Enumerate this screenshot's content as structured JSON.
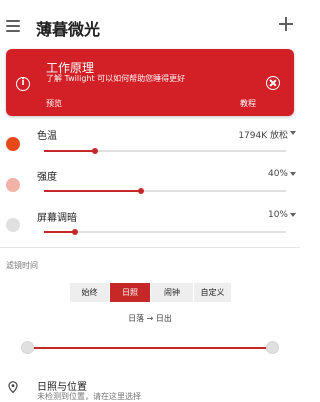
{
  "app": {
    "title": "薄暮微光"
  },
  "info_card": {
    "title": "工作原理",
    "subtitle": "了解 Twilight 可以如何帮助您睡得更好",
    "preview_label": "预览",
    "tutorial_label": "教程"
  },
  "settings": [
    {
      "label": "色温",
      "value": "1794K 放松",
      "level": 0.21,
      "dot_color": "#e64a19"
    },
    {
      "label": "强度",
      "value": "40%",
      "level": 0.4,
      "dot_color": "#f2b3a7"
    },
    {
      "label": "屏幕调暗",
      "value": "10%",
      "level": 0.13,
      "dot_color": "#e0e0e0"
    }
  ],
  "filter": {
    "section_title": "滤镜时间",
    "modes": [
      "始终",
      "日照",
      "闹钟",
      "自定义"
    ],
    "selected_mode": "日照",
    "schedule_note": "日落 → 日出"
  },
  "location": {
    "title": "日照与位置",
    "subtitle": "未检测到位置，请在这里选择"
  },
  "colors": {
    "accent": "#c62828",
    "card": "#d32027"
  }
}
